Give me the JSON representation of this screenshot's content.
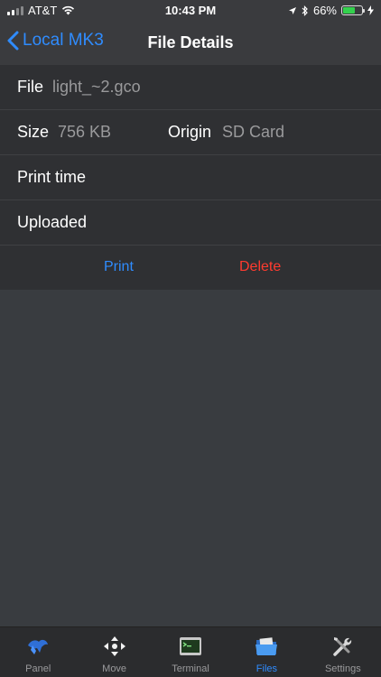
{
  "status": {
    "carrier": "AT&T",
    "time": "10:43 PM",
    "battery": "66%",
    "battery_level": 0.66
  },
  "nav": {
    "back_label": "Local MK3",
    "title": "File Details"
  },
  "details": {
    "file_label": "File",
    "file_value": "light_~2.gco",
    "size_label": "Size",
    "size_value": "756 KB",
    "origin_label": "Origin",
    "origin_value": "SD Card",
    "print_time_label": "Print time",
    "uploaded_label": "Uploaded"
  },
  "actions": {
    "print": "Print",
    "delete": "Delete"
  },
  "tabs": [
    {
      "label": "Panel",
      "icon": "panel-icon"
    },
    {
      "label": "Move",
      "icon": "move-icon"
    },
    {
      "label": "Terminal",
      "icon": "terminal-icon"
    },
    {
      "label": "Files",
      "icon": "files-icon",
      "active": true
    },
    {
      "label": "Settings",
      "icon": "settings-icon"
    }
  ],
  "colors": {
    "accent": "#2f8cff",
    "danger": "#ff3b2f",
    "battery": "#33d14d"
  }
}
